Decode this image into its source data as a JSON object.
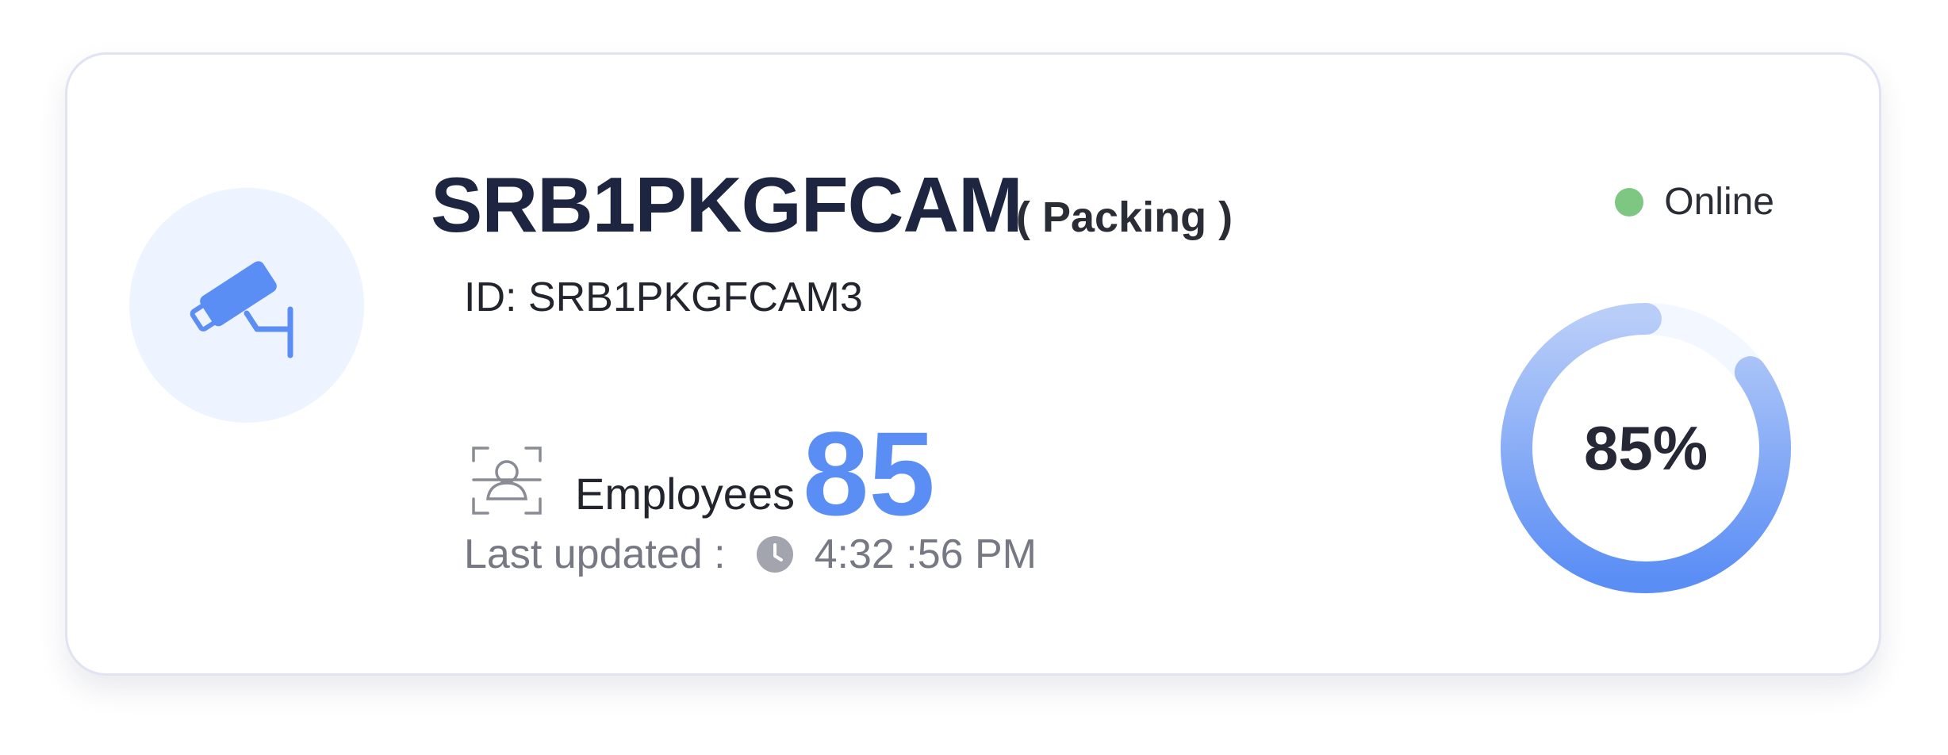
{
  "camera": {
    "name": "SRB1PKGFCAM",
    "zone": "( Packing )",
    "id_label": "ID: SRB1PKGFCAM3",
    "status": "Online",
    "status_color": "#7dc782",
    "icon": "security-camera-icon"
  },
  "employees": {
    "label": "Employees",
    "count": "85",
    "icon": "face-scan-icon"
  },
  "last_updated": {
    "label": "Last updated :",
    "time": "4:32 :56 PM",
    "icon": "clock-icon"
  },
  "gauge": {
    "percent": 85,
    "label": "85%",
    "colors": {
      "start": "#b8cdf8",
      "end": "#5b8ef5",
      "track": "#f3f7ff"
    }
  },
  "colors": {
    "accent": "#5b8ef5",
    "title": "#1d2541",
    "muted": "#767883"
  }
}
